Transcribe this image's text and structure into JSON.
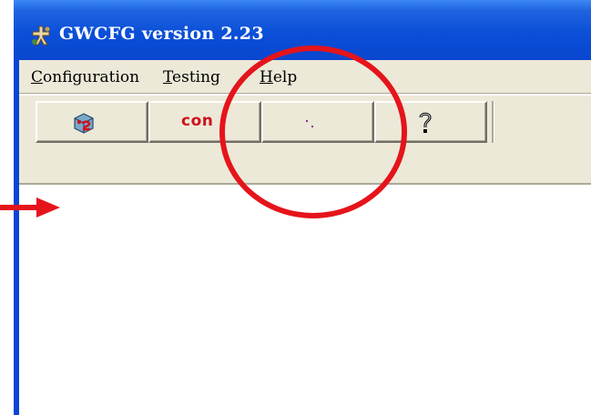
{
  "window": {
    "title": "GWCFG version 2.23"
  },
  "menubar": {
    "items": [
      {
        "accel": "C",
        "rest": "onfiguration"
      },
      {
        "accel": "T",
        "rest": "esting"
      },
      {
        "accel": "H",
        "rest": "elp"
      }
    ]
  },
  "toolbar": {
    "buttons": [
      {
        "icon": "config-icon",
        "label": ""
      },
      {
        "icon": "",
        "label": "con"
      },
      {
        "icon": "dots-icon",
        "label": ""
      },
      {
        "icon": "help-question-icon",
        "label": ""
      }
    ]
  },
  "colors": {
    "titlebar": "#0a46cf",
    "face": "#ece9d8",
    "annotation": "#e5141b",
    "con_label": "#d0111b"
  }
}
